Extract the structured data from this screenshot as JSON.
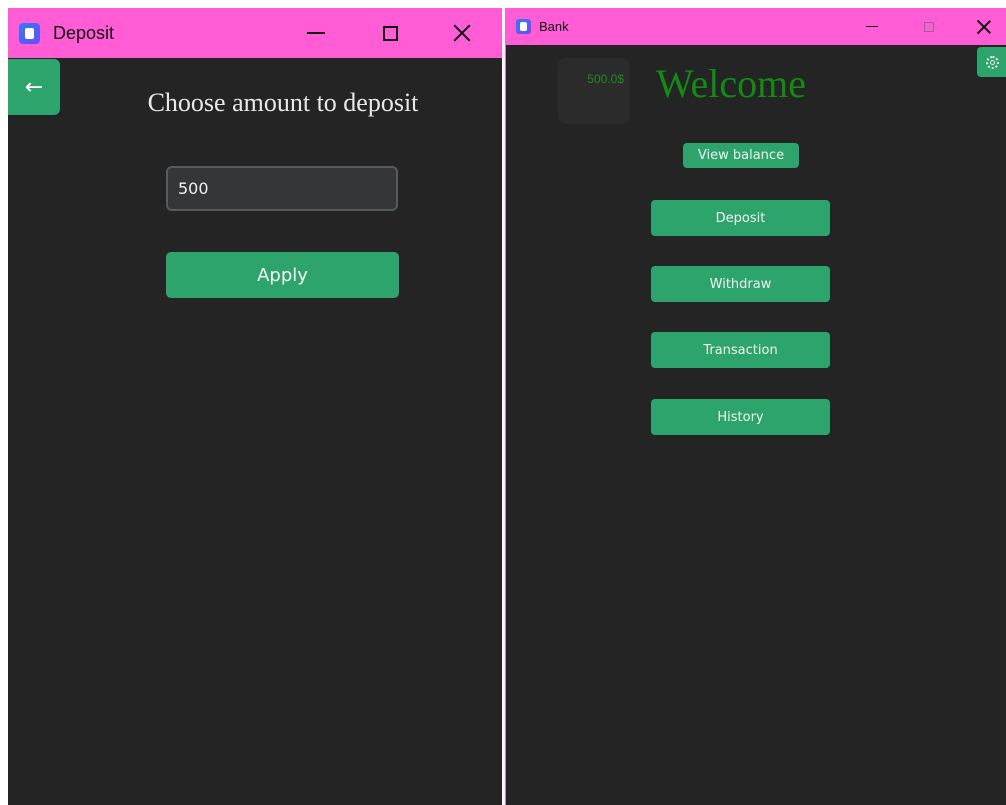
{
  "deposit_window": {
    "title": "Deposit",
    "back_icon": "←",
    "heading": "Choose amount to deposit",
    "amount_value": "500",
    "apply_label": "Apply"
  },
  "bank_window": {
    "title": "Bank",
    "balance": "500.0$",
    "welcome": "Welcome",
    "view_balance_label": "View balance",
    "menu": [
      {
        "label": "Deposit"
      },
      {
        "label": "Withdraw"
      },
      {
        "label": "Transaction"
      },
      {
        "label": "History"
      }
    ]
  },
  "icons": {
    "app": "app-icon",
    "back": "arrow-left-icon",
    "settings": "gear-icon",
    "minimize": "minimize-icon",
    "maximize": "maximize-icon",
    "close": "close-icon"
  },
  "colors": {
    "titlebar": "#ff5cd6",
    "window_bg": "#242424",
    "accent_green": "#2ea46d",
    "welcome_green": "#138a13",
    "balance_green": "#1f8a1f",
    "input_bg": "#343638",
    "input_border": "#565b5e"
  }
}
